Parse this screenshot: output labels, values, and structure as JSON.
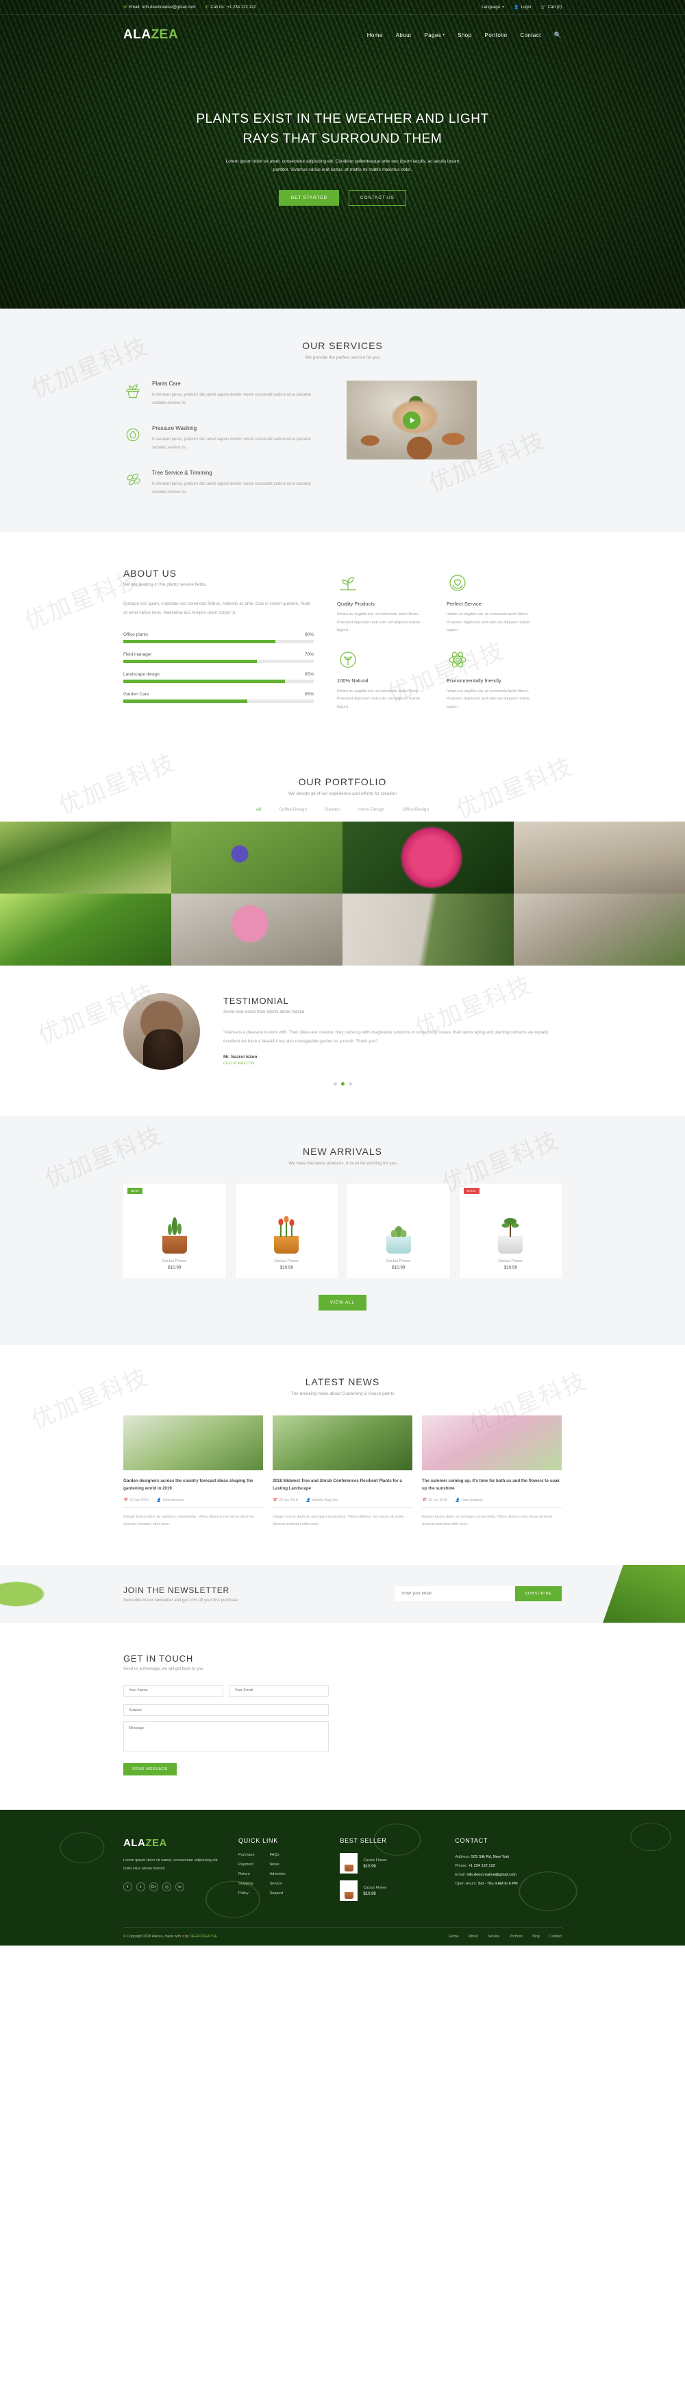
{
  "topbar": {
    "email_label": "Email:",
    "email": "info.deercreative@gmail.com",
    "phone_label": "Call Us:",
    "phone": "+1 234 122 122",
    "language": "Language",
    "login": "Login",
    "cart": "Cart (0)"
  },
  "brand": {
    "part1": "ALA",
    "part2": "ZEA"
  },
  "nav": {
    "items": [
      {
        "label": "Home",
        "has_caret": false
      },
      {
        "label": "About",
        "has_caret": false
      },
      {
        "label": "Pages",
        "has_caret": true
      },
      {
        "label": "Shop",
        "has_caret": false
      },
      {
        "label": "Portfolio",
        "has_caret": false
      },
      {
        "label": "Contact",
        "has_caret": false
      }
    ],
    "search_icon": "search-icon"
  },
  "hero": {
    "title": "PLANTS EXIST IN THE WEATHER AND LIGHT RAYS THAT SURROUND THEM",
    "subtitle": "Lorem ipsum dolor sit amet, consectetur adipiscing elit. Curabitur pellentesque ante nec ipsum iaculis, ac iaculis ipsum porttitor. Vivamus varius erat luctus, at mattis mi mattis maximus dolor.",
    "primary_button": "GET STARTED",
    "secondary_button": "CONTACT US"
  },
  "services": {
    "title": "OUR SERVICES",
    "subtitle": "We provide the perfect service for you",
    "items": [
      {
        "icon": "potted-plant-icon",
        "title": "Plants Care",
        "text": "In Aenean purus, pretium sito amet sapien denim moste consectet sedoni urna placerat sodales.service its."
      },
      {
        "icon": "water-drop-icon",
        "title": "Pressure Washing",
        "text": "In Aenean purus, pretium sito amet sapien denim moste consectet sedoni urna placerat sodales.service its."
      },
      {
        "icon": "leaves-icon",
        "title": "Tree Service & Trimming",
        "text": "In Aenean purus, pretium sito amet sapien denim moste consectet sedoni urna placerat sodales.service its."
      }
    ],
    "video_play_icon": "play-icon"
  },
  "about": {
    "title": "ABOUT US",
    "subtitle": "We are leading in the plants service fields.",
    "body": "Quisque orci quam, vulputate non commodo finibus, molestie ac ante. Duis in sceleri quesem. Nulla sit amet varius nunc. Maecenas dui, tempev ullam corper in.",
    "skills": [
      {
        "label": "Office plants",
        "value": 80,
        "value_text": "80%"
      },
      {
        "label": "Field manager",
        "value": 70,
        "value_text": "70%"
      },
      {
        "label": "Landscape design",
        "value": 85,
        "value_text": "85%"
      },
      {
        "label": "Garden Care",
        "value": 65,
        "value_text": "65%"
      }
    ],
    "features": [
      {
        "icon": "sprout-icon",
        "title": "Quality Products",
        "text": "Intiam eu sagittis est. at commodo lacini libero. Praesent dignissim sed odio vel aliquam manta lagorn."
      },
      {
        "icon": "hands-heart-icon",
        "title": "Perfect Service",
        "text": "Intiam eu sagittis est. at commodo lacini libero. Praesent dignissim sed odio vel aliquam manta lagorn."
      },
      {
        "icon": "tree-circle-icon",
        "title": "100% Natural",
        "text": "Intiam eu sagittis est. at commodo lacini libero. Praesent dignissim sed odio vel aliquam manta lagorn."
      },
      {
        "icon": "atom-leaf-icon",
        "title": "Environmentally friendly",
        "text": "Intiam eu sagittis est. at commodo lacini libero. Praesent dignissim sed odio vel aliquam manta lagorn."
      }
    ]
  },
  "portfolio": {
    "title": "OUR PORTFOLIO",
    "subtitle": "We devote all of our experience and efforts for creation",
    "filters": [
      {
        "label": "All",
        "active": true
      },
      {
        "label": "Coffee Design",
        "active": false
      },
      {
        "label": "Garden",
        "active": false
      },
      {
        "label": "Home Design",
        "active": false
      },
      {
        "label": "Office Design",
        "active": false
      }
    ],
    "items": [
      {
        "name": "garden-pond"
      },
      {
        "name": "blue-muscari"
      },
      {
        "name": "pink-bromeliad"
      },
      {
        "name": "office-desk-plant"
      },
      {
        "name": "green-fern"
      },
      {
        "name": "pink-peonies"
      },
      {
        "name": "hanging-plants"
      },
      {
        "name": "indoor-plant"
      }
    ]
  },
  "testimonial": {
    "title": "TESTIMONIAL",
    "subtitle": "Some kind words from clients about Alazea",
    "quote": "\"Alazea is a pleasure to work with. Their ideas are creative, they came up with imaginative solutions to some tricky issues, their landscaping and planting contacts are equally excellent we have a beautiful but also manageable garden as a result. Thank you!\"",
    "author": "Mr. Nazrul Islam",
    "role": "CEO of MAXTON",
    "dots": 3,
    "active_dot": 1
  },
  "arrivals": {
    "title": "NEW ARRIVALS",
    "subtitle": "We have the latest products, it must be exciting for you",
    "products": [
      {
        "badge": "NEW",
        "badge_type": "new",
        "name": "Cactus Flower",
        "price": "$10.99",
        "pot": "terracotta"
      },
      {
        "badge": "",
        "badge_type": "",
        "name": "Cactus Flower",
        "price": "$10.99",
        "pot": "orange"
      },
      {
        "badge": "",
        "badge_type": "",
        "name": "Cactus Flower",
        "price": "$10.99",
        "pot": "blue"
      },
      {
        "badge": "SALE",
        "badge_type": "sale",
        "name": "Cactus Flower",
        "price": "$10.99",
        "pot": "white"
      }
    ],
    "view_all": "VIEW ALL"
  },
  "news": {
    "title": "LATEST NEWS",
    "subtitle": "The breaking news about Gardening & House plants",
    "posts": [
      {
        "title": "Garden designers across the country forecast ideas shaping the gardening world in 2019",
        "date": "20 Jun 2018",
        "author": "Deer Andreas",
        "excerpt": "Integer luctus diam ac aumque consectetur. Vitius ullamco nec lacus sit amet. Aenean interdou nibh esse."
      },
      {
        "title": "2018 Midwest Tree and Shrub Conferences Resilient Plants for a Lasting Landscape",
        "date": "20 Jun 2018",
        "author": "Monika Hug Res",
        "excerpt": "Integer luctus diam ac aumque consectetur. Vitius ullamco nec lacus sit amet. Aenean interdou nibh esse."
      },
      {
        "title": "The summer coming up, it's time for both us and the flowers to soak up the sunshine",
        "date": "20 Jun 2018",
        "author": "Deer Andreas",
        "excerpt": "Integer luctus diam ac aumque consectetur. Vitius ullamco nec lacus sit amet. Aenean interdou nibh esse."
      }
    ]
  },
  "newsletter": {
    "title": "JOIN THE NEWSLETTER",
    "subtitle": "Subscribe to our newsletter and get 10% off your first purchase",
    "placeholder": "Enter your email",
    "value": "",
    "button": "SUBSCRIBE"
  },
  "contact": {
    "title": "GET IN TOUCH",
    "subtitle": "Send us a message, we will get back to you",
    "name_placeholder": "Your Name",
    "email_placeholder": "Your Email",
    "subject_placeholder": "Subject",
    "message_placeholder": "Message",
    "button": "SEND MESSAGE"
  },
  "footer": {
    "brand": {
      "part1": "ALA",
      "part2": "ZEA"
    },
    "description": "Lorem ipsum dolor sit samet, consectetur adipiscing elit. India situs atione mantor",
    "socials": [
      {
        "icon": "facebook-icon",
        "glyph": "f"
      },
      {
        "icon": "twitter-icon",
        "glyph": "t"
      },
      {
        "icon": "google-plus-icon",
        "glyph": "G+"
      },
      {
        "icon": "instagram-icon",
        "glyph": "◎"
      },
      {
        "icon": "linkedin-icon",
        "glyph": "in"
      }
    ],
    "quick_link": {
      "title": "QUICK LINK",
      "col1": [
        "Purchase",
        "Payment",
        "Return",
        "Shipping",
        "Policy"
      ],
      "col2": [
        "FAQs",
        "News",
        "Advertise",
        "Service",
        "Support"
      ]
    },
    "best_seller": {
      "title": "BEST SELLER",
      "items": [
        {
          "name": "Cactus Flower",
          "price": "$10.99"
        },
        {
          "name": "Cactus Flower",
          "price": "$10.99"
        }
      ]
    },
    "contact": {
      "title": "CONTACT",
      "address_label": "Address:",
      "address": "505 Silk Rd, New York",
      "phone_label": "Phone:",
      "phone": "+1 234 122 122",
      "email_label": "Email:",
      "email": "info.deercreative@gmail.com",
      "hours_label": "Open Hours:",
      "hours": "Sat - Thu 9 AM to 6 PM"
    },
    "bottom": {
      "copyright": "© Copyright 2018 Alazea, made with",
      "heart": "♥",
      "by": "by",
      "brand": "DEERCREATIVE",
      "links": [
        "Home",
        "About",
        "Service",
        "Portfolio",
        "Blog",
        "Contact"
      ]
    }
  },
  "watermarks": [
    "优加星科技",
    "优加星科技",
    "优加星科技",
    "优加星科技",
    "优加星科技",
    "优加星科技",
    "优加星科技",
    "优加星科技",
    "优加星科技",
    "优加星科技",
    "优加星科技",
    "优加星科技"
  ]
}
